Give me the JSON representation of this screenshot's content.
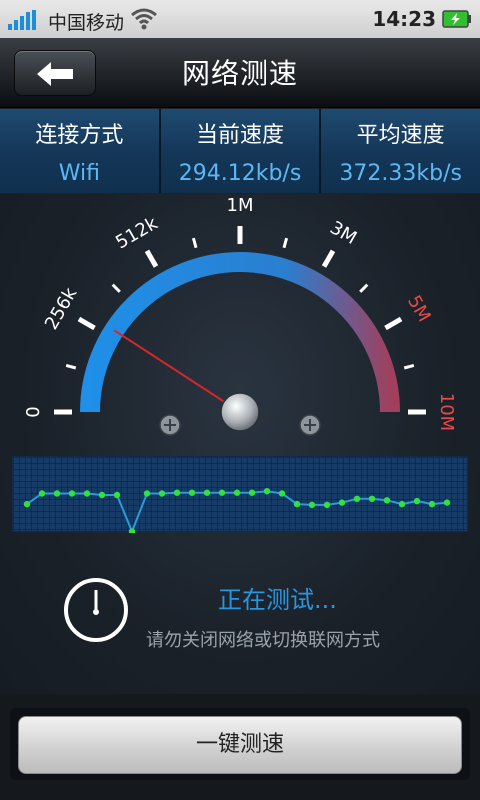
{
  "status_bar": {
    "carrier": "中国移动",
    "time": "14:23",
    "signal_level": 1.0,
    "battery_charging": true,
    "icons": [
      "signal-icon",
      "wifi-icon",
      "battery-charging-icon"
    ]
  },
  "header": {
    "title": "网络测速",
    "back_icon": "back-arrow-icon"
  },
  "stats": [
    {
      "label": "连接方式",
      "value": "Wifi"
    },
    {
      "label": "当前速度",
      "value": "294.12kb/s"
    },
    {
      "label": "平均速度",
      "value": "372.33kb/s"
    }
  ],
  "gauge": {
    "tick_labels": [
      "0",
      "256k",
      "512k",
      "1M",
      "3M",
      "5M",
      "10M"
    ],
    "needle_label_position": 1.1,
    "colors": {
      "arc_start": "#1f8fe8",
      "arc_end": "#a0405e",
      "needle": "#d8262a",
      "red_label": "#e84a4a"
    }
  },
  "speed_graph": {
    "values": [
      0.62,
      0.48,
      0.48,
      0.48,
      0.48,
      0.5,
      0.5,
      0.98,
      0.48,
      0.48,
      0.47,
      0.47,
      0.47,
      0.47,
      0.47,
      0.47,
      0.45,
      0.48,
      0.62,
      0.63,
      0.63,
      0.6,
      0.55,
      0.55,
      0.57,
      0.62,
      0.58,
      0.62,
      0.6
    ],
    "line_color": "#2e9ad8",
    "point_color": "#2fe23f"
  },
  "testing": {
    "title": "正在测试...",
    "hint": "请勿关闭网络或切换联网方式",
    "icon": "timer-icon"
  },
  "footer": {
    "button_label": "一键测速"
  }
}
